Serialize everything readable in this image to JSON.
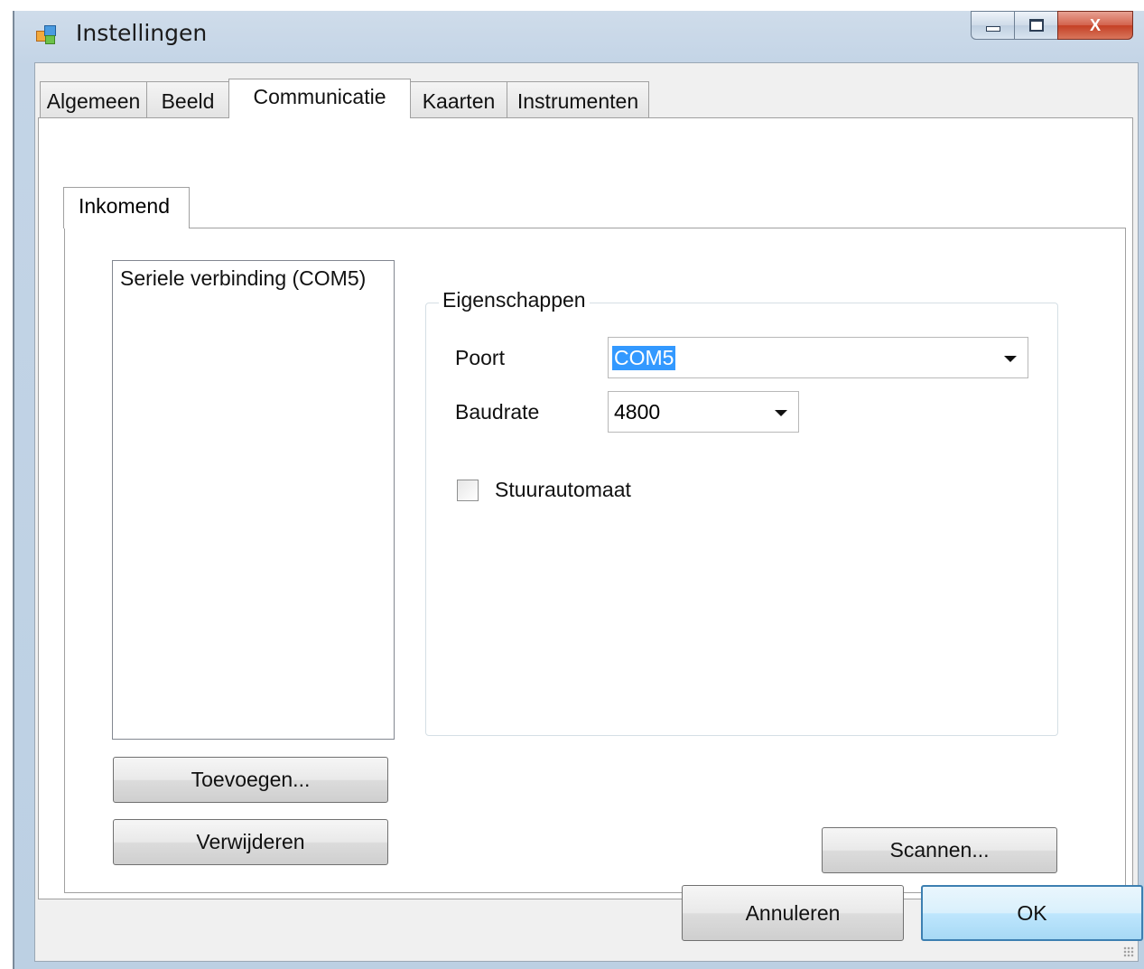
{
  "window": {
    "title": "Instellingen",
    "icon": "app-settings-icon",
    "caption_buttons": [
      "minimize",
      "maximize",
      "close"
    ],
    "close_label": "X"
  },
  "tabs": {
    "items": [
      {
        "label": "Algemeen"
      },
      {
        "label": "Beeld"
      },
      {
        "label": "Communicatie",
        "active": true
      },
      {
        "label": "Kaarten"
      },
      {
        "label": "Instrumenten"
      }
    ]
  },
  "inner_tab": {
    "label": "Inkomend"
  },
  "connections": {
    "items": [
      "Seriele verbinding (COM5)"
    ]
  },
  "properties": {
    "group_title": "Eigenschappen",
    "port_label": "Poort",
    "port_value": "COM5",
    "baud_label": "Baudrate",
    "baud_value": "4800",
    "autopilot_label": "Stuurautomaat",
    "autopilot_checked": false
  },
  "buttons": {
    "add": "Toevoegen...",
    "remove": "Verwijderen",
    "scan": "Scannen...",
    "cancel": "Annuleren",
    "ok": "OK"
  },
  "colors": {
    "selection": "#3399ff",
    "default_button_border": "#3c7fb1"
  }
}
